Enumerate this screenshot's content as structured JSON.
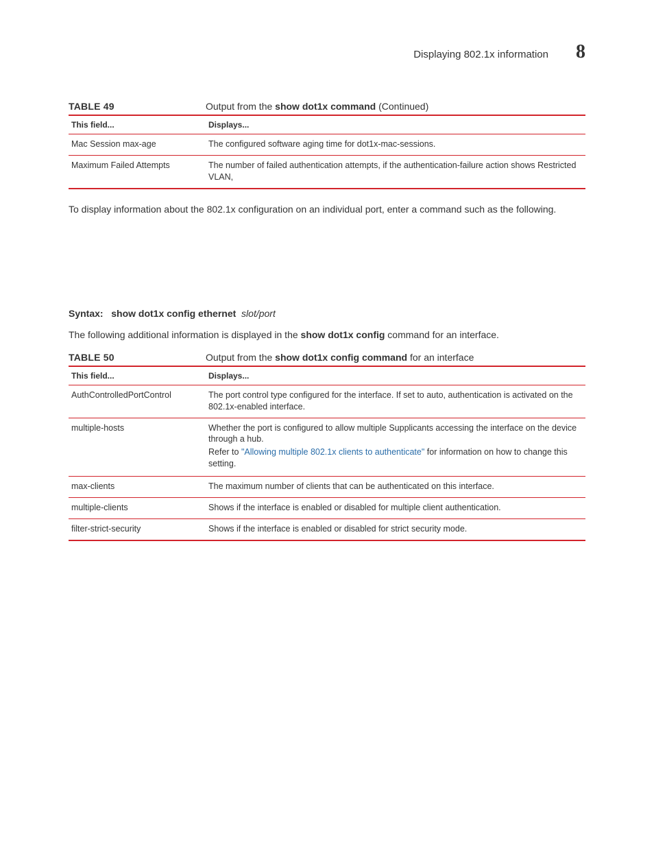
{
  "header": {
    "title": "Displaying 802.1x information",
    "chapter": "8"
  },
  "table49": {
    "label": "TABLE 49",
    "caption_pre": "Output from the ",
    "caption_bold": "show dot1x command",
    "caption_post": "  (Continued)",
    "head_col1": "This field...",
    "head_col2": "Displays...",
    "rows": [
      {
        "f": "Mac Session max-age",
        "d": "The configured software aging time for dot1x-mac-sessions."
      },
      {
        "f": "Maximum Failed Attempts",
        "d": "The number of failed authentication attempts, if the authentication-failure action shows Restricted VLAN,"
      }
    ]
  },
  "para1": "To display information about the 802.1x configuration on an individual port, enter a command such as the following.",
  "syntax": {
    "label": "Syntax:",
    "cmd": "show dot1x config ethernet",
    "arg": "slot/port"
  },
  "para2_pre": "The following additional information is displayed in the ",
  "para2_bold": "show dot1x config",
  "para2_post": " command for an interface.",
  "table50": {
    "label": "TABLE 50",
    "caption_pre": "Output from the ",
    "caption_bold": "show dot1x config command",
    "caption_post": " for an interface",
    "head_col1": "This field...",
    "head_col2": "Displays...",
    "rows": {
      "r1": {
        "f": "AuthControlledPortControl",
        "d": "The port control type configured for the interface.  If set to auto, authentication is activated on the 802.1x-enabled interface."
      },
      "r2": {
        "f": "multiple-hosts",
        "d1": "Whether the port is configured to allow multiple Supplicants accessing the interface on the device through a hub.",
        "d2_pre": "Refer to ",
        "d2_link": "\"Allowing multiple 802.1x clients to authenticate\"",
        "d2_post": " for information on how to change this setting."
      },
      "r3": {
        "f": "max-clients",
        "d": "The maximum number of clients that can be authenticated on this interface."
      },
      "r4": {
        "f": "multiple-clients",
        "d": "Shows if the interface is enabled or disabled for multiple client authentication."
      },
      "r5": {
        "f": "filter-strict-security",
        "d": "Shows if the interface is enabled or disabled for strict security mode."
      }
    }
  }
}
